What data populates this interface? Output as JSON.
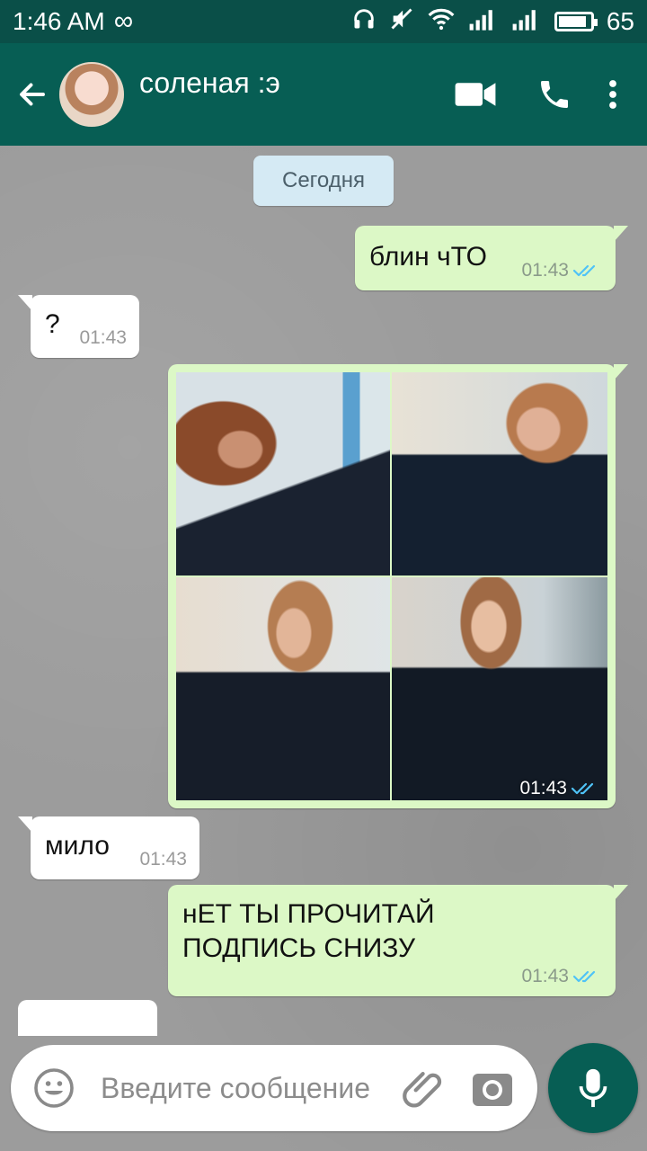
{
  "status_bar": {
    "time": "1:46 AM",
    "infinity_glyph": "∞",
    "battery_level": "65",
    "icons": [
      "headphones-icon",
      "mute-icon",
      "wifi-icon",
      "signal-icon",
      "signal-icon",
      "battery-icon"
    ]
  },
  "header": {
    "contact_name": "соленая :э",
    "icons": [
      "back-arrow-icon",
      "video-call-icon",
      "phone-call-icon",
      "more-vert-icon"
    ],
    "bg_color": "#075e54"
  },
  "chat": {
    "date_label": "Сегодня",
    "messages": [
      {
        "direction": "out",
        "text": "блин чТО",
        "time": "01:43",
        "status": "read"
      },
      {
        "direction": "in",
        "text": "?",
        "time": "01:43"
      },
      {
        "direction": "out",
        "type": "image",
        "time": "01:43",
        "status": "read"
      },
      {
        "direction": "in",
        "text": "мило",
        "time": "01:43"
      },
      {
        "direction": "out",
        "text_lines": [
          "нЕТ ТЫ ПРОЧИТАЙ",
          "ПОДПИСЬ СНИЗУ"
        ],
        "time": "01:43",
        "status": "read"
      }
    ]
  },
  "composer": {
    "placeholder": "Введите сообщение",
    "icons": [
      "emoji-icon",
      "attach-icon",
      "camera-icon",
      "mic-icon"
    ]
  },
  "colors": {
    "outgoing_bubble": "#dcf8c6",
    "incoming_bubble": "#ffffff",
    "read_tick": "#4fc3f7",
    "date_chip": "#d5eaf4"
  }
}
